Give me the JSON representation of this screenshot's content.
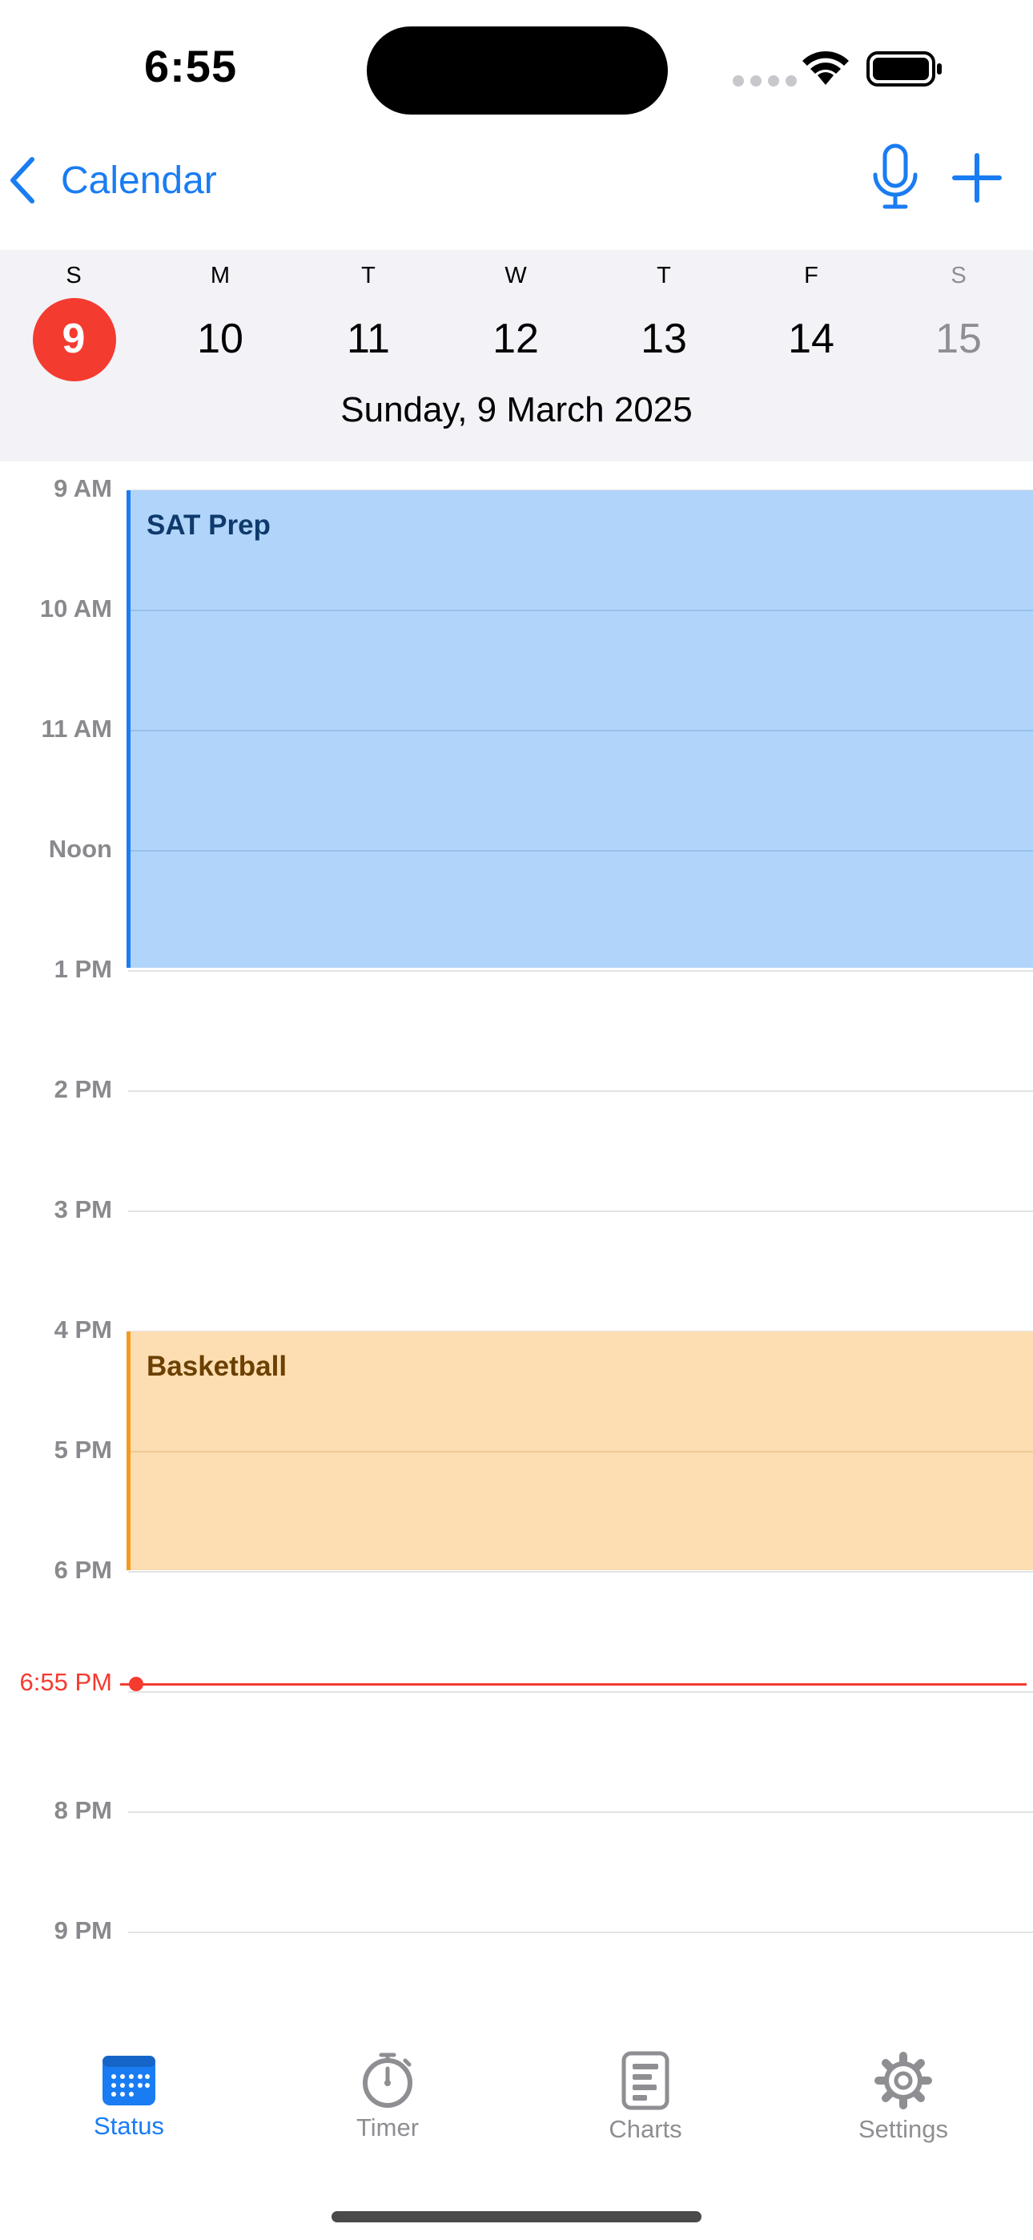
{
  "status_bar": {
    "time": "6:55"
  },
  "nav": {
    "back_label": "Calendar"
  },
  "week": {
    "days": [
      {
        "letter": "S",
        "num": "9"
      },
      {
        "letter": "M",
        "num": "10"
      },
      {
        "letter": "T",
        "num": "11"
      },
      {
        "letter": "W",
        "num": "12"
      },
      {
        "letter": "T",
        "num": "13"
      },
      {
        "letter": "F",
        "num": "14"
      },
      {
        "letter": "S",
        "num": "15"
      }
    ],
    "selected_date": "Sunday, 9 March 2025"
  },
  "timeline": {
    "hours": [
      "9 AM",
      "10 AM",
      "11 AM",
      "Noon",
      "1 PM",
      "2 PM",
      "3 PM",
      "4 PM",
      "5 PM",
      "6 PM",
      "8 PM",
      "9 PM"
    ],
    "now_label": "6:55 PM",
    "events": [
      {
        "title": "SAT Prep",
        "color": "#b1d5fa",
        "accent": "#1a7cf2"
      },
      {
        "title": "Basketball",
        "color": "#fddeb2",
        "accent": "#f29a1f"
      }
    ]
  },
  "tabs": [
    {
      "label": "Status",
      "icon": "calendar-icon",
      "active": true
    },
    {
      "label": "Timer",
      "icon": "stopwatch-icon",
      "active": false
    },
    {
      "label": "Charts",
      "icon": "list-chart-icon",
      "active": false
    },
    {
      "label": "Settings",
      "icon": "gear-icon",
      "active": false
    }
  ],
  "colors": {
    "accent": "#1a7cf2",
    "today": "#f43b30",
    "now": "#f43b30"
  }
}
